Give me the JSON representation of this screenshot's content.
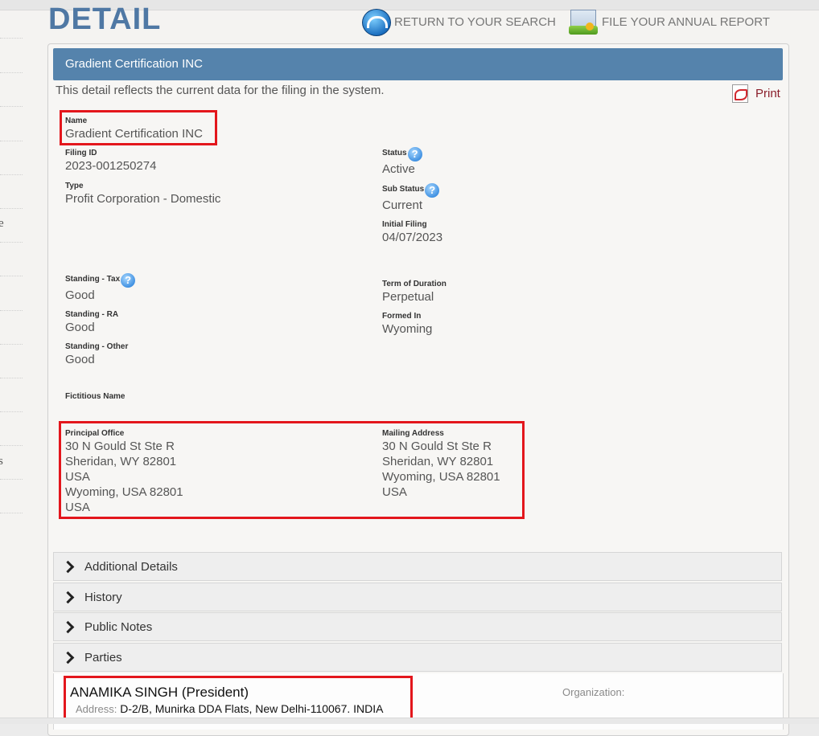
{
  "header": {
    "title": "DETAIL",
    "return_link": "RETURN TO YOUR SEARCH",
    "report_link": "FILE YOUR ANNUAL REPORT"
  },
  "sidebar_fragments": [
    "e",
    "s"
  ],
  "panel": {
    "entity_title": "Gradient Certification INC",
    "intro": "This detail reflects the current data for the filing in the system.",
    "print_label": "Print"
  },
  "fields": {
    "name": {
      "label": "Name",
      "value": "Gradient Certification INC"
    },
    "filing_id": {
      "label": "Filing ID",
      "value": "2023-001250274"
    },
    "type": {
      "label": "Type",
      "value": "Profit Corporation - Domestic"
    },
    "status": {
      "label": "Status",
      "value": "Active"
    },
    "sub_status": {
      "label": "Sub Status",
      "value": "Current"
    },
    "initial_filing": {
      "label": "Initial Filing",
      "value": "04/07/2023"
    },
    "standing_tax": {
      "label": "Standing - Tax",
      "value": "Good"
    },
    "standing_ra": {
      "label": "Standing - RA",
      "value": "Good"
    },
    "standing_other": {
      "label": "Standing - Other",
      "value": "Good"
    },
    "term_of_duration": {
      "label": "Term of Duration",
      "value": "Perpetual"
    },
    "formed_in": {
      "label": "Formed In",
      "value": "Wyoming"
    },
    "fictitious_name": {
      "label": "Fictitious Name",
      "value": ""
    },
    "principal_office": {
      "label": "Principal Office",
      "lines": [
        "30 N Gould St Ste R",
        "Sheridan, WY 82801",
        "USA",
        "Wyoming, USA 82801",
        "USA"
      ]
    },
    "mailing_address": {
      "label": "Mailing Address",
      "lines": [
        "30 N Gould St Ste R",
        "Sheridan, WY 82801",
        "Wyoming, USA 82801",
        "USA"
      ]
    }
  },
  "help_icon_glyph": "?",
  "sections": [
    "Additional Details",
    "History",
    "Public Notes",
    "Parties"
  ],
  "parties": {
    "name": "ANAMIKA SINGH (President)",
    "address_label": "Address:",
    "address": "D-2/B, Munirka DDA Flats, New Delhi-110067. INDIA",
    "organization_label": "Organization:"
  },
  "colors": {
    "title_blue": "#4f78a4",
    "header_blue": "#5583ac",
    "highlight_red": "#e3161c",
    "print_red": "#8a1e2a"
  }
}
